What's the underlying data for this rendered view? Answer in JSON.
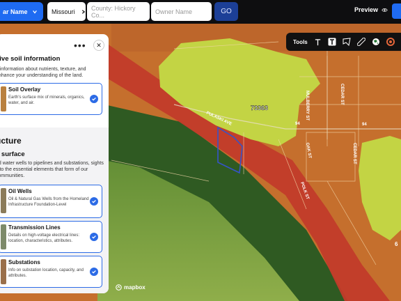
{
  "topbar": {
    "search_button_label": "ar Name",
    "state_value": "Missouri",
    "county_placeholder": "County: Hickory Co...",
    "owner_placeholder": "Owner Name",
    "go_label": "GO",
    "preview_label": "Preview"
  },
  "toolbar": {
    "label": "Tools",
    "icons": [
      "text-icon",
      "text-box-icon",
      "polygon-icon",
      "ruler-icon",
      "globe-icon",
      "target-icon",
      "scissors-icon"
    ]
  },
  "panel": {
    "soil_heading": "sive soil information",
    "soil_desc": "e information about nutrients, texture, and enhance your understanding of the land.",
    "soil_card": {
      "title": "Soil Overlay",
      "desc": "Earth's surface mix of minerals, organics, water, and air."
    },
    "infra_heading": "ucture",
    "infra_subheading": "e surface",
    "infra_desc": "nd water wells to pipelines and substations, sights into the essential elements that form of our communities.",
    "cards": [
      {
        "title": "Oil Wells",
        "desc": "Oil & Natural Gas Wells from the Homeland Infrastructure Foundation-Level"
      },
      {
        "title": "Transmission Lines",
        "desc": "Details on high-voltage electrical lines: location, characteristics, attributes."
      },
      {
        "title": "Substations",
        "desc": "Info on substation location, capacity, and attributes."
      }
    ]
  },
  "map": {
    "labels": {
      "parcel_id": "73363",
      "road_a": "94",
      "road_b": "94",
      "street_1": "MULBERRY ST",
      "street_2": "CEDAR ST",
      "street_3": "OAK ST",
      "street_4": "CEDAR ST",
      "street_5": "POLK ST",
      "street_6": "PULASKI AVE",
      "edge_num": "6"
    },
    "attribution": "mapbox"
  },
  "colors": {
    "accent": "#1f6bf2",
    "red_zone": "#c93a2a",
    "orange_zone": "#d9772e",
    "yellow_zone": "#c9d94a",
    "green_zone": "#3c6e2a"
  }
}
